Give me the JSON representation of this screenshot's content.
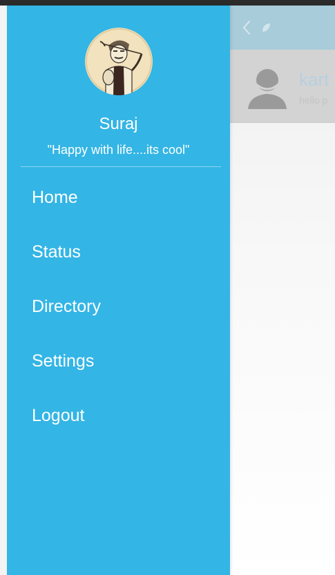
{
  "background_app": {
    "contact_name": "kart",
    "contact_message": "hello p",
    "toolbar_color": "#a8ccd9",
    "back_icon": "chevron-left-icon",
    "app_icon": "leaf-icon",
    "avatar_icon": "person-silhouette-icon"
  },
  "drawer": {
    "background": "#33b5e5",
    "profile": {
      "name": "Suraj",
      "status": "\"Happy with life....its cool\"",
      "photo_icon": "profile-photo-sketch"
    },
    "nav_items": [
      {
        "label": "Home"
      },
      {
        "label": "Status"
      },
      {
        "label": "Directory"
      },
      {
        "label": "Settings"
      },
      {
        "label": "Logout"
      }
    ]
  }
}
